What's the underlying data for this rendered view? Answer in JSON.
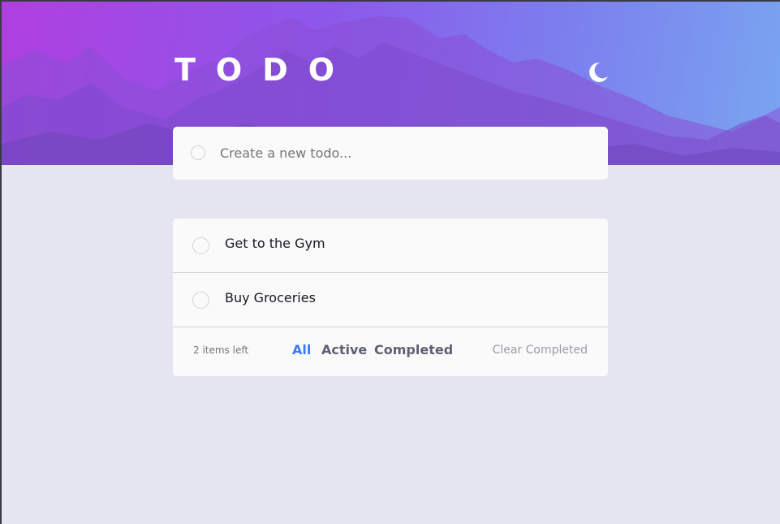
{
  "header": {
    "title": "TODO",
    "theme_icon": "moon-icon"
  },
  "new_todo": {
    "placeholder": "Create a new todo..."
  },
  "todos": [
    {
      "text": "Get to the Gym",
      "completed": false
    },
    {
      "text": "Buy Groceries",
      "completed": false
    }
  ],
  "footer": {
    "items_left": "2 items left",
    "filters": [
      {
        "label": "All",
        "active": true
      },
      {
        "label": "Active",
        "active": false
      },
      {
        "label": "Completed",
        "active": false
      }
    ],
    "clear_label": "Clear Completed"
  },
  "colors": {
    "background": "#e4e5f1",
    "card": "#fafafa",
    "accent": "#3a7bfd",
    "hero_gradient_start": "#b03fe0",
    "hero_gradient_end": "#79a5f0"
  }
}
